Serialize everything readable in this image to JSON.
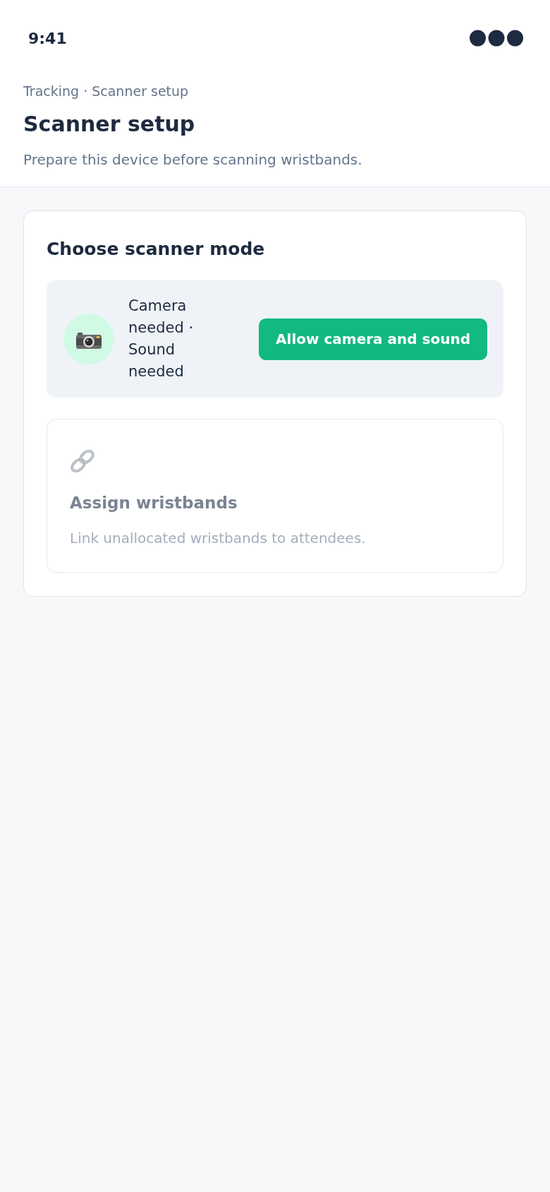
{
  "status_bar": {
    "time": "9:41"
  },
  "header": {
    "breadcrumb": "Tracking · Scanner setup",
    "title": "Scanner setup",
    "subtitle": "Prepare this device before scanning wristbands."
  },
  "mode_card": {
    "title": "Choose scanner mode",
    "permission": {
      "status": "Camera needed · Sound needed",
      "button": "Allow camera and sound"
    },
    "modes": [
      {
        "title": "Assign wristbands",
        "description": "Link unallocated wristbands to attendees.",
        "disabled": true
      }
    ]
  }
}
